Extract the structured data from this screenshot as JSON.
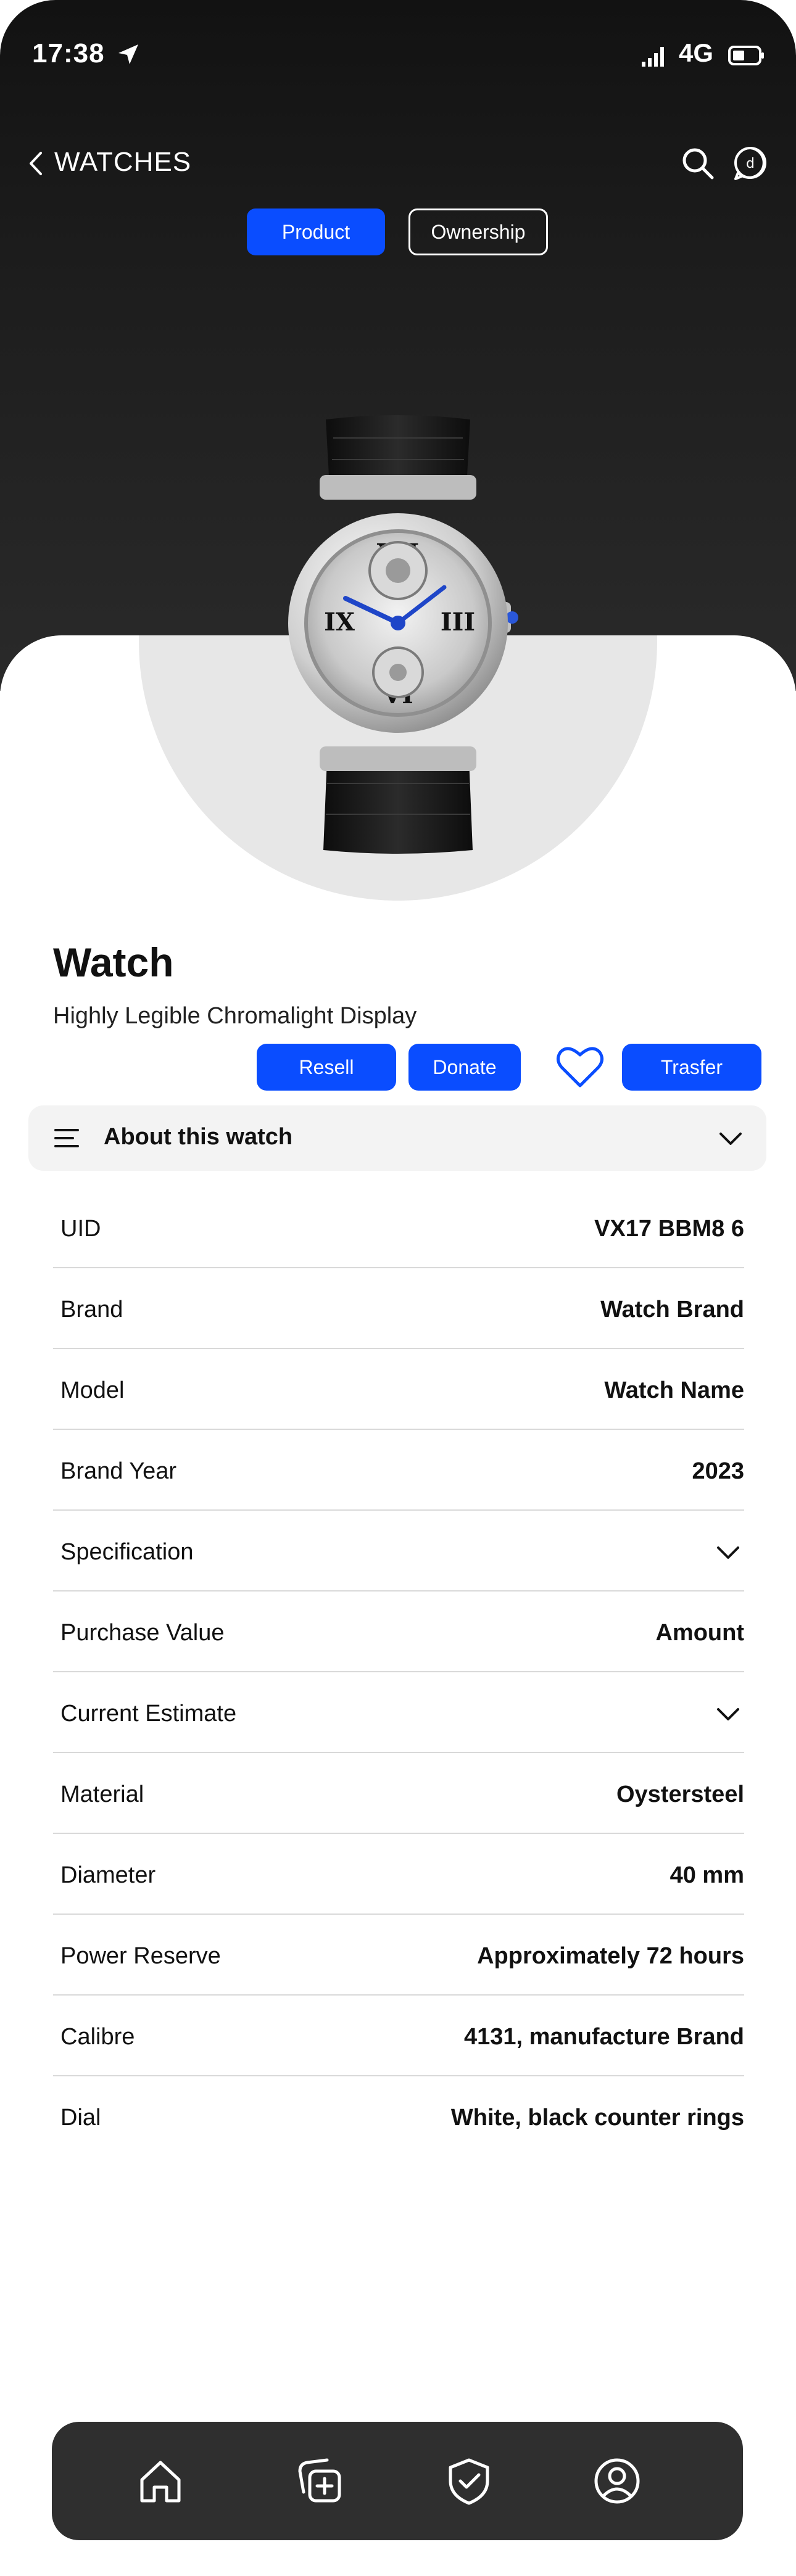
{
  "status_bar": {
    "time": "17:38",
    "network": "4G"
  },
  "nav": {
    "title": "WATCHES"
  },
  "tabs": {
    "product": "Product",
    "ownership": "Ownership"
  },
  "product": {
    "title": "Watch",
    "subtitle": "Highly Legible Chromalight Display"
  },
  "actions": {
    "resell": "Resell",
    "donate": "Donate",
    "transfer": "Trasfer"
  },
  "about": {
    "label": "About this watch"
  },
  "details": [
    {
      "key": "UID",
      "value": "VX17 BBM8 6"
    },
    {
      "key": "Brand",
      "value": "Watch Brand"
    },
    {
      "key": "Model",
      "value": "Watch Name"
    },
    {
      "key": "Brand Year",
      "value": "2023"
    },
    {
      "key": "Specification",
      "value": ""
    },
    {
      "key": "Purchase Value",
      "value": "Amount"
    },
    {
      "key": "Current Estimate",
      "value": ""
    },
    {
      "key": "Material",
      "value": "Oystersteel"
    },
    {
      "key": "Diameter",
      "value": "40 mm"
    },
    {
      "key": "Power Reserve",
      "value": "Approximately 72 hours"
    },
    {
      "key": "Calibre",
      "value": "4131, manufacture Brand"
    },
    {
      "key": "Dial",
      "value": "White, black counter rings"
    }
  ],
  "colors": {
    "accent": "#0a4dff",
    "header_bg": "#1d1d1d",
    "tabbar_bg": "#2f2f2f",
    "sheet_bg": "#ffffff",
    "panel_bg": "#f3f3f3"
  },
  "icons": {
    "status": [
      "location-arrow-icon",
      "signal-icon",
      "battery-icon"
    ],
    "nav": [
      "back-chevron-icon",
      "search-icon",
      "chat-icon"
    ],
    "tabbar": [
      "home-icon",
      "add-collection-icon",
      "shield-check-icon",
      "profile-icon"
    ]
  }
}
